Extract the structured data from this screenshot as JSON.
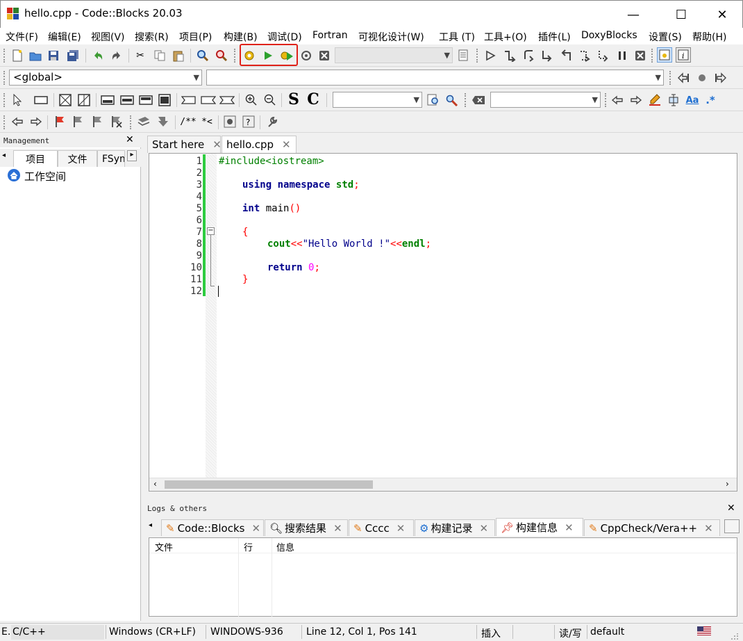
{
  "window": {
    "title": "hello.cpp - Code::Blocks 20.03",
    "minimize": "—",
    "maximize": "☐",
    "close": "✕"
  },
  "menu": [
    "文件(F)",
    "编辑(E)",
    "视图(V)",
    "搜索(R)",
    "项目(P)",
    "构建(B)",
    "调试(D)",
    "Fortran",
    "可视化设计(W)",
    "工具 (T)",
    "工具+(O)",
    "插件(L)",
    "DoxyBlocks",
    "设置(S)",
    "帮助(H)"
  ],
  "toolbar": {
    "build_target_combo": "",
    "scope_combo": "<global>",
    "symbol_combo": "",
    "search_combo": "",
    "replace_combo": "",
    "s_label": "S",
    "c_label": "C",
    "doxy_comment": "/**",
    "doxy_inline": "*<",
    "regex_label": ".*",
    "aa_label": "Aa"
  },
  "highlight_color": "#e0221a",
  "management": {
    "title": "Management",
    "tabs": [
      "项目",
      "文件",
      "FSym"
    ],
    "workspace": "工作空间"
  },
  "editor": {
    "tabs": [
      "Start here",
      "hello.cpp"
    ],
    "active_tab": "hello.cpp",
    "lines": [
      {
        "n": "1"
      },
      {
        "n": "2"
      },
      {
        "n": "3"
      },
      {
        "n": "4"
      },
      {
        "n": "5"
      },
      {
        "n": "6"
      },
      {
        "n": "7"
      },
      {
        "n": "8"
      },
      {
        "n": "9"
      },
      {
        "n": "10"
      },
      {
        "n": "11"
      },
      {
        "n": "12"
      }
    ],
    "code": {
      "l1": "#include<iostream>",
      "l3_kw1": "using",
      "l3_kw2": "namespace",
      "l3_id": "std",
      "l3_semi": ";",
      "l5_kw": "int",
      "l5_id": "main",
      "l5_paren": "()",
      "l7": "{",
      "l8_id": "cout",
      "l8_op1": "<<",
      "l8_str": "\"Hello World !\"",
      "l8_op2": "<<",
      "l8_id2": "endl",
      "l8_semi": ";",
      "l10_kw": "return",
      "l10_num": "0",
      "l10_semi": ";",
      "l11": "}"
    }
  },
  "logs": {
    "title": "Logs & others",
    "tabs": [
      "Code::Blocks",
      "搜索结果",
      "Cccc",
      "构建记录",
      "构建信息",
      "CppCheck/Vera++"
    ],
    "active_tab": "构建信息",
    "columns": [
      "文件",
      "行",
      "信息"
    ]
  },
  "status": {
    "lang": "C/C++",
    "lang_prefix": "E.",
    "eol": "Windows (CR+LF)",
    "encoding": "WINDOWS-936",
    "position": "Line 12, Col 1, Pos 141",
    "mode": "插入",
    "rw": "读/写",
    "profile": "default"
  }
}
